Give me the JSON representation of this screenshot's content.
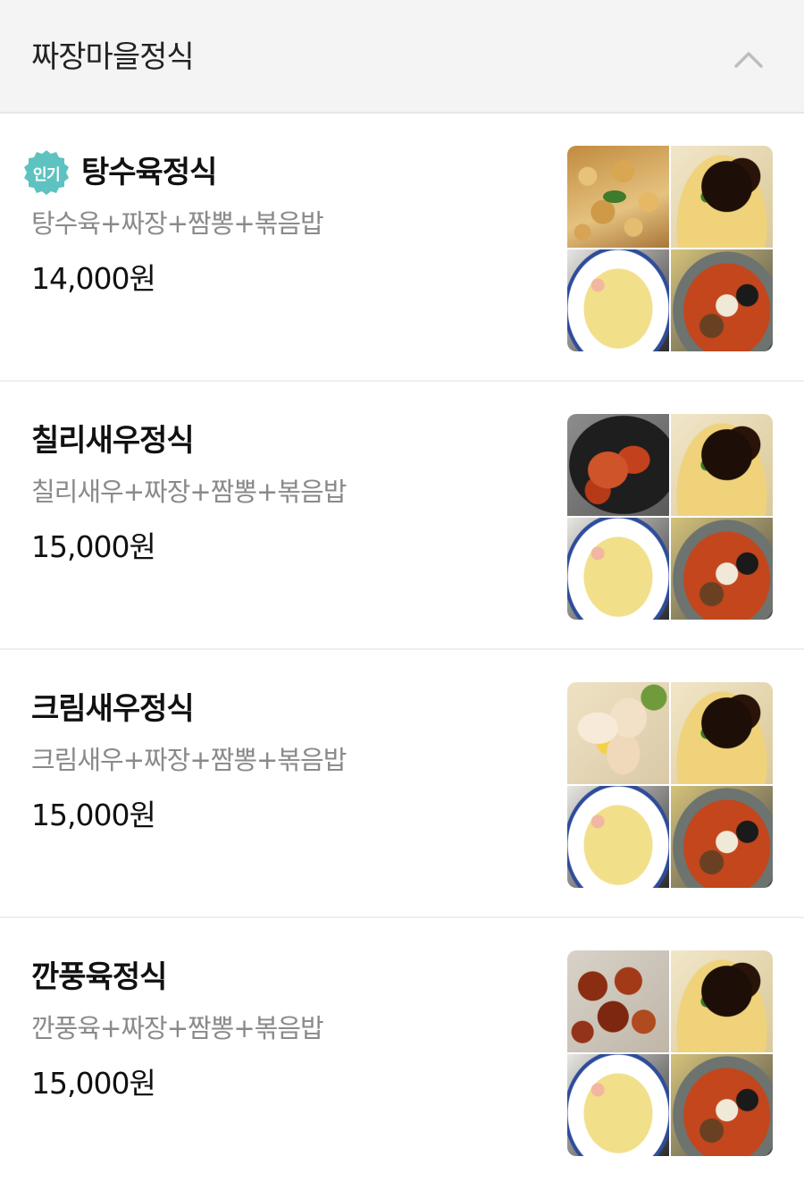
{
  "category": {
    "title": "짜장마을정식",
    "collapse_icon": "chevron-up-icon"
  },
  "items": [
    {
      "badge": "인기",
      "name": "탕수육정식",
      "description": "탕수육+짜장+짬뽕+볶음밥",
      "price": "14,000원"
    },
    {
      "badge": "",
      "name": "칠리새우정식",
      "description": "칠리새우+짜장+짬뽕+볶음밥",
      "price": "15,000원"
    },
    {
      "badge": "",
      "name": "크림새우정식",
      "description": "크림새우+짜장+짬뽕+볶음밥",
      "price": "15,000원"
    },
    {
      "badge": "",
      "name": "깐풍육정식",
      "description": "깐풍육+짜장+짬뽕+볶음밥",
      "price": "15,000원"
    }
  ],
  "colors": {
    "badge": "#5ec3c0",
    "header_bg": "#f4f4f4",
    "description": "#8a8a8a"
  }
}
